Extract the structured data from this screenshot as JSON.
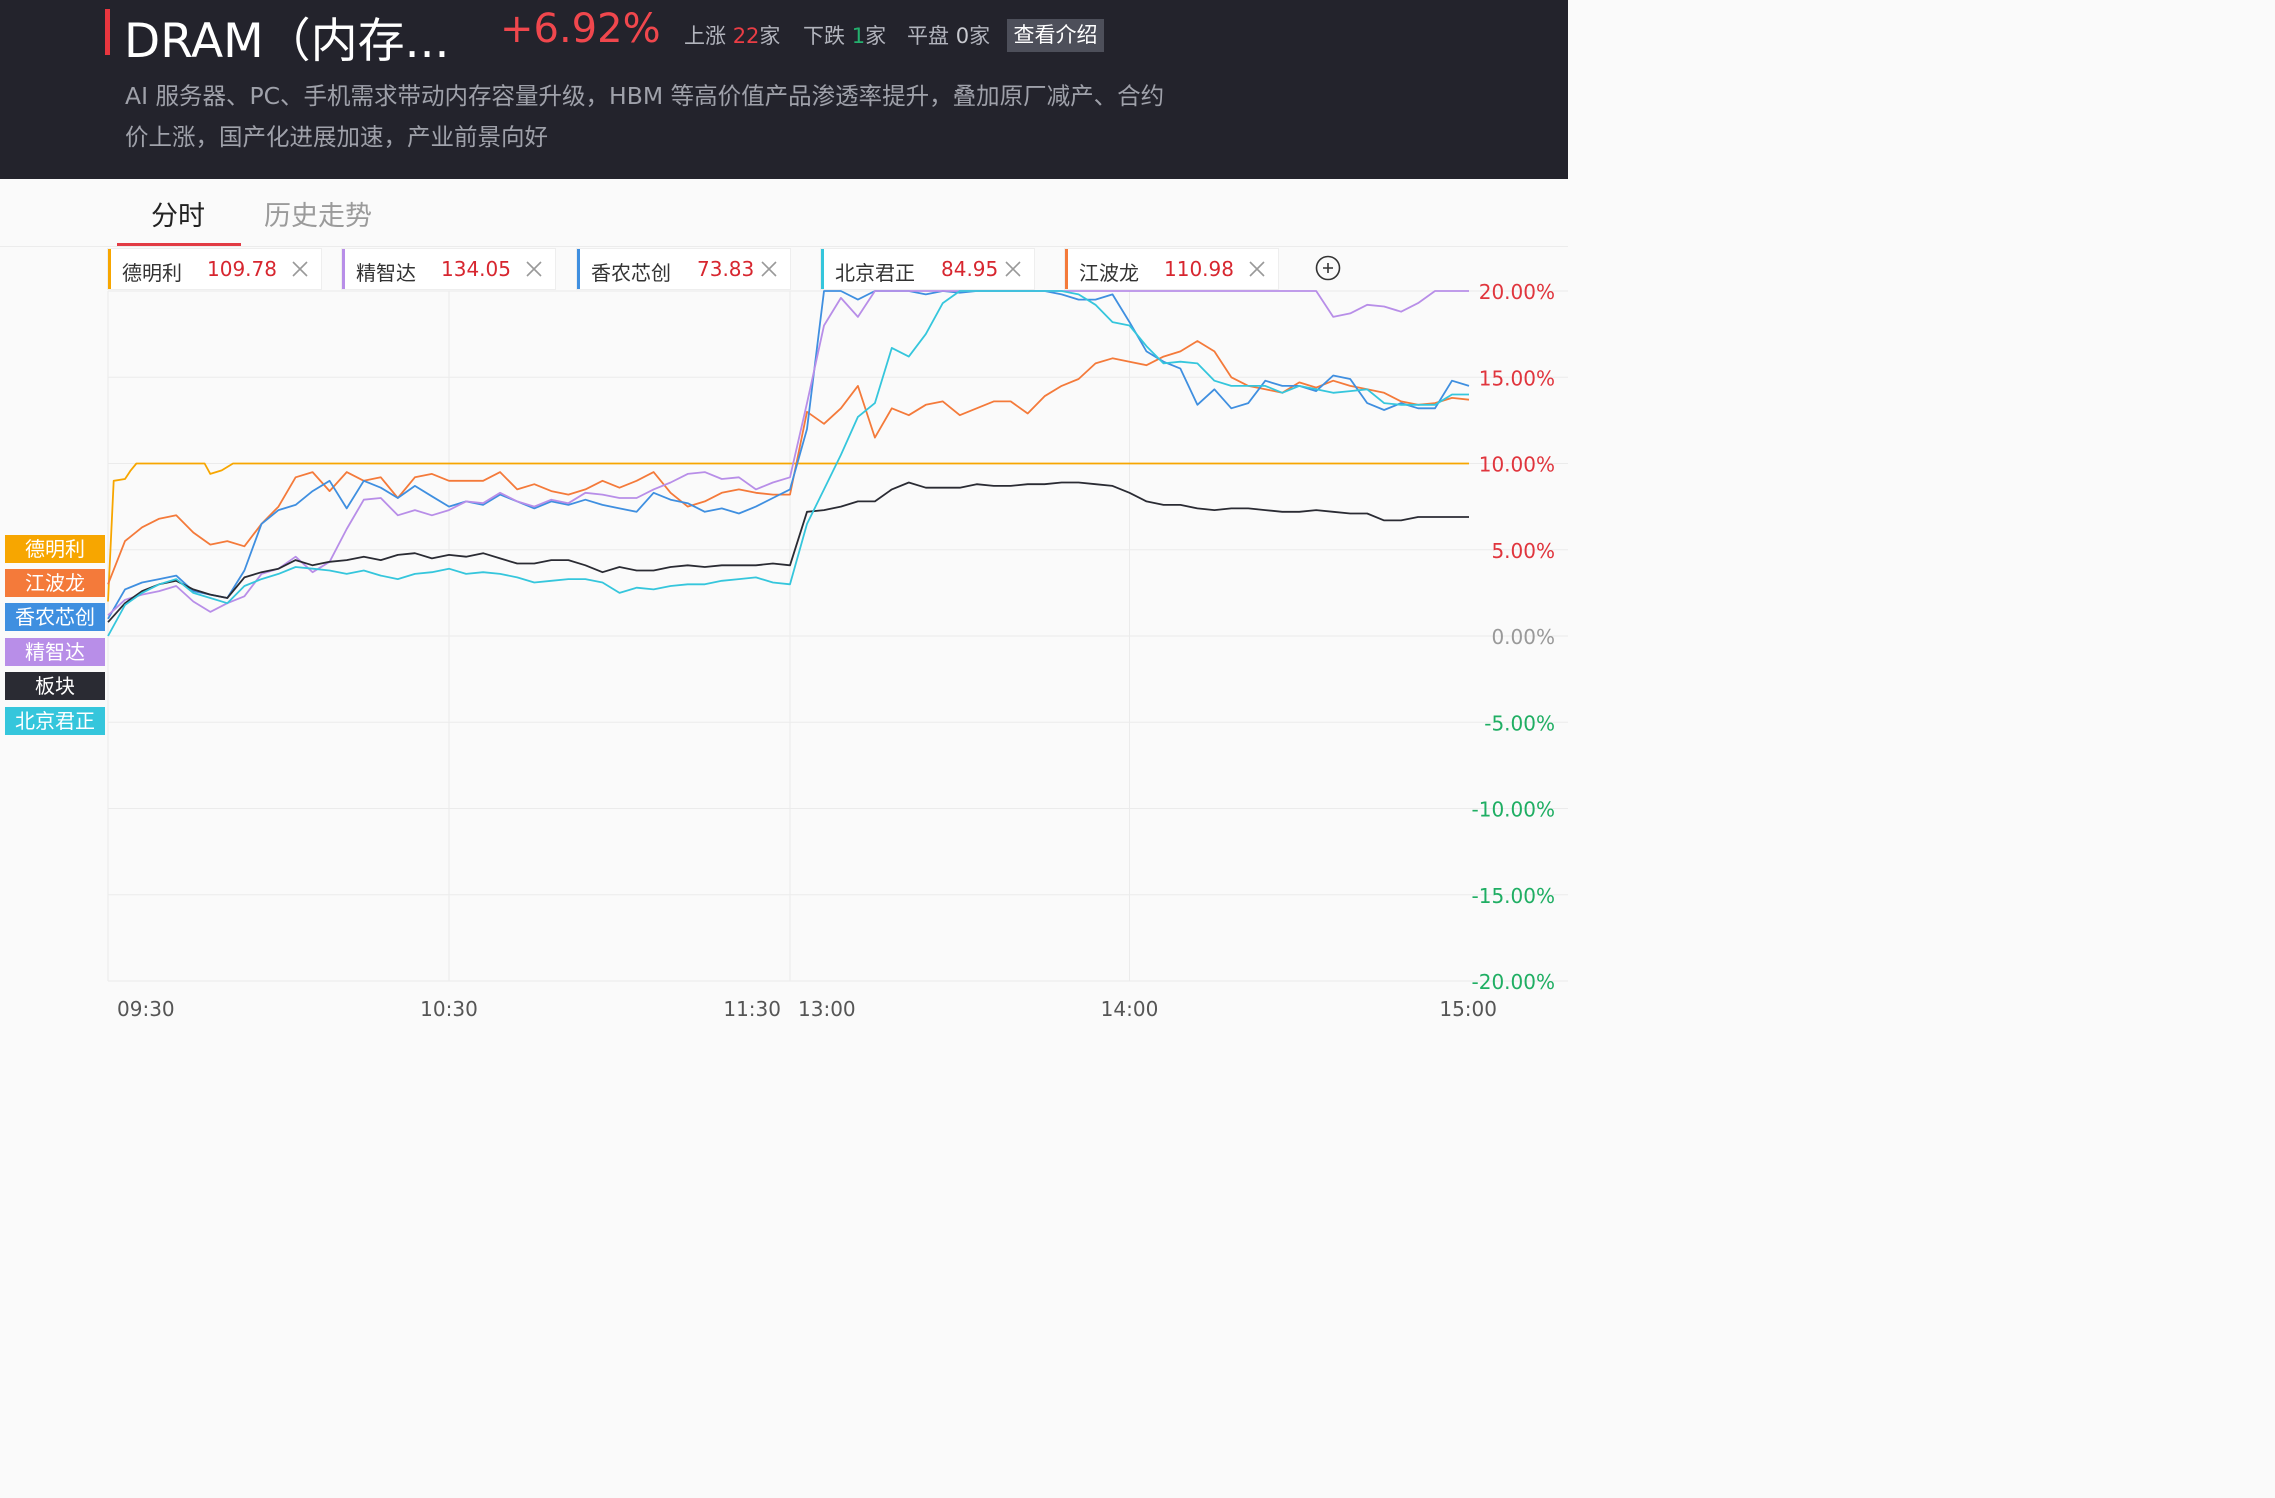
{
  "header": {
    "title": "DRAM（内存...",
    "change": "+6.92%",
    "up_label": "上涨",
    "up_count": "22",
    "up_unit": "家",
    "down_label": "下跌",
    "down_count": "1",
    "down_unit": "家",
    "flat_label": "平盘",
    "flat_count": "0",
    "flat_unit": "家",
    "intro_button": "查看介绍",
    "description": "AI 服务器、PC、手机需求带动内存容量升级，HBM 等高价值产品渗透率提升，叠加原厂减产、合约价上涨，国产化进展加速，产业前景向好"
  },
  "tabs": [
    {
      "label": "分时",
      "active": true
    },
    {
      "label": "历史走势",
      "active": false
    }
  ],
  "chips": [
    {
      "name": "德明利",
      "price": "109.78",
      "color": "#f7a600"
    },
    {
      "name": "精智达",
      "price": "134.05",
      "color": "#b88ee8"
    },
    {
      "name": "香农芯创",
      "price": "73.83",
      "color": "#3f8fe0"
    },
    {
      "name": "北京君正",
      "price": "84.95",
      "color": "#35c6dc"
    },
    {
      "name": "江波龙",
      "price": "110.98",
      "color": "#f47a3a"
    }
  ],
  "legend": [
    {
      "name": "德明利",
      "color": "#f7a600"
    },
    {
      "name": "江波龙",
      "color": "#f47a3a"
    },
    {
      "name": "香农芯创",
      "color": "#3f8fe0"
    },
    {
      "name": "精智达",
      "color": "#b88ee8"
    },
    {
      "name": "板块",
      "color": "#2a2b33"
    },
    {
      "name": "北京君正",
      "color": "#35c6dc"
    }
  ],
  "chart_data": {
    "type": "line",
    "ylim": [
      -20,
      20
    ],
    "y_ticks": [
      "20.00%",
      "15.00%",
      "10.00%",
      "5.00%",
      "0.00%",
      "-5.00%",
      "-10.00%",
      "-15.00%",
      "-20.00%"
    ],
    "x_ticks": [
      "09:30",
      "10:30",
      "11:30",
      "13:00",
      "14:00",
      "15:00"
    ],
    "x_range": [
      0,
      240
    ],
    "positive_color": "#e0353d",
    "negative_color": "#1fae63",
    "neutral_color": "#999999",
    "series": [
      {
        "name": "德明利",
        "color": "#f7a600",
        "x": [
          0,
          1,
          3,
          4,
          5,
          7,
          17,
          18,
          20,
          22,
          60,
          120,
          240
        ],
        "values": [
          2,
          9,
          9.1,
          9.6,
          10,
          10,
          10,
          9.4,
          9.6,
          10,
          10,
          10,
          10
        ]
      },
      {
        "name": "江波龙",
        "color": "#f47a3a",
        "x": [
          0,
          3,
          6,
          9,
          12,
          15,
          18,
          21,
          24,
          27,
          30,
          33,
          36,
          39,
          42,
          45,
          48,
          51,
          54,
          57,
          60,
          63,
          66,
          69,
          72,
          75,
          78,
          81,
          84,
          87,
          90,
          93,
          96,
          99,
          102,
          105,
          108,
          111,
          114,
          117,
          120,
          123,
          126,
          129,
          132,
          135,
          138,
          141,
          144,
          147,
          150,
          153,
          156,
          159,
          162,
          165,
          168,
          171,
          174,
          177,
          180,
          183,
          186,
          189,
          192,
          195,
          198,
          201,
          204,
          207,
          210,
          213,
          216,
          219,
          222,
          225,
          228,
          231,
          234,
          237,
          240
        ],
        "values": [
          3,
          5.5,
          6.3,
          6.8,
          7,
          6,
          5.3,
          5.5,
          5.2,
          6.5,
          7.5,
          9.2,
          9.5,
          8.4,
          9.5,
          9,
          9.2,
          8,
          9.2,
          9.4,
          9,
          9,
          9,
          9.5,
          8.5,
          8.8,
          8.4,
          8.2,
          8.5,
          9,
          8.6,
          9,
          9.5,
          8.3,
          7.5,
          7.8,
          8.3,
          8.5,
          8.3,
          8.2,
          8.2,
          13,
          12.3,
          13.2,
          14.5,
          11.5,
          13.2,
          12.8,
          13.4,
          13.6,
          12.8,
          13.2,
          13.6,
          13.6,
          12.9,
          13.9,
          14.5,
          14.9,
          15.8,
          16.1,
          15.9,
          15.7,
          16.2,
          16.5,
          17.1,
          16.5,
          15,
          14.5,
          14.3,
          14.1,
          14.7,
          14.4,
          14.8,
          14.5,
          14.3,
          14.1,
          13.6,
          13.4,
          13.5,
          13.8,
          13.7
        ]
      },
      {
        "name": "香农芯创",
        "color": "#3f8fe0",
        "x": [
          0,
          3,
          6,
          9,
          12,
          15,
          18,
          21,
          24,
          27,
          30,
          33,
          36,
          39,
          42,
          45,
          48,
          51,
          54,
          57,
          60,
          63,
          66,
          69,
          72,
          75,
          78,
          81,
          84,
          87,
          90,
          93,
          96,
          99,
          102,
          105,
          108,
          111,
          114,
          117,
          120,
          123,
          126,
          129,
          132,
          135,
          138,
          141,
          144,
          147,
          150,
          153,
          156,
          159,
          162,
          165,
          168,
          171,
          174,
          177,
          180,
          183,
          186,
          189,
          192,
          195,
          198,
          201,
          204,
          207,
          210,
          213,
          216,
          219,
          222,
          225,
          228,
          231,
          234,
          237,
          240
        ],
        "values": [
          1,
          2.7,
          3.1,
          3.3,
          3.5,
          2.6,
          2.4,
          2.2,
          3.8,
          6.5,
          7.3,
          7.6,
          8.4,
          9,
          7.4,
          9,
          8.6,
          8,
          8.7,
          8.1,
          7.5,
          7.8,
          7.6,
          8.2,
          7.8,
          7.4,
          7.8,
          7.6,
          7.9,
          7.6,
          7.4,
          7.2,
          8.3,
          7.9,
          7.7,
          7.2,
          7.4,
          7.1,
          7.5,
          8,
          8.5,
          12,
          20,
          20,
          19.5,
          20,
          20,
          20,
          19.8,
          20,
          19.9,
          20,
          20,
          20,
          20,
          20,
          19.8,
          19.5,
          19.5,
          19.8,
          18.2,
          16.5,
          15.9,
          15.5,
          13.4,
          14.3,
          13.2,
          13.5,
          14.8,
          14.5,
          14.5,
          14.2,
          15.1,
          14.9,
          13.5,
          13.1,
          13.5,
          13.2,
          13.2,
          14.8,
          14.5
        ]
      },
      {
        "name": "精智达",
        "color": "#b88ee8",
        "x": [
          0,
          3,
          6,
          9,
          12,
          15,
          18,
          21,
          24,
          27,
          30,
          33,
          36,
          39,
          42,
          45,
          48,
          51,
          54,
          57,
          60,
          63,
          66,
          69,
          72,
          75,
          78,
          81,
          84,
          87,
          90,
          93,
          96,
          99,
          102,
          105,
          108,
          111,
          114,
          117,
          120,
          123,
          126,
          129,
          132,
          135,
          138,
          141,
          144,
          147,
          150,
          153,
          156,
          159,
          162,
          165,
          168,
          171,
          174,
          177,
          180,
          183,
          186,
          189,
          192,
          195,
          198,
          201,
          204,
          207,
          210,
          213,
          216,
          219,
          222,
          225,
          228,
          231,
          234,
          237,
          240
        ],
        "values": [
          1.2,
          2.1,
          2.4,
          2.6,
          2.9,
          2,
          1.4,
          1.9,
          2.3,
          3.6,
          3.9,
          4.6,
          3.7,
          4.3,
          6.2,
          7.9,
          8,
          7,
          7.3,
          7,
          7.3,
          7.8,
          7.7,
          8.3,
          7.8,
          7.5,
          7.9,
          7.7,
          8.3,
          8.2,
          8,
          8,
          8.5,
          8.9,
          9.4,
          9.5,
          9.1,
          9.2,
          8.5,
          8.9,
          9.2,
          13.5,
          18,
          19.6,
          18.5,
          20,
          20,
          20,
          20,
          20,
          20,
          20,
          20,
          20,
          20,
          20,
          20,
          20,
          20,
          20,
          20,
          20,
          20,
          20,
          20,
          20,
          20,
          20,
          20,
          20,
          20,
          20,
          18.5,
          18.7,
          19.2,
          19.1,
          18.8,
          19.3,
          20,
          20,
          20
        ]
      },
      {
        "name": "板块",
        "color": "#2a2b33",
        "x": [
          0,
          3,
          6,
          9,
          12,
          15,
          18,
          21,
          24,
          27,
          30,
          33,
          36,
          39,
          42,
          45,
          48,
          51,
          54,
          57,
          60,
          63,
          66,
          69,
          72,
          75,
          78,
          81,
          84,
          87,
          90,
          93,
          96,
          99,
          102,
          105,
          108,
          111,
          114,
          117,
          120,
          123,
          126,
          129,
          132,
          135,
          138,
          141,
          144,
          147,
          150,
          153,
          156,
          159,
          162,
          165,
          168,
          171,
          174,
          177,
          180,
          183,
          186,
          189,
          192,
          195,
          198,
          201,
          204,
          207,
          210,
          213,
          216,
          219,
          222,
          225,
          228,
          231,
          234,
          237,
          240
        ],
        "values": [
          0.8,
          1.9,
          2.6,
          3,
          3.2,
          2.7,
          2.4,
          2.2,
          3.4,
          3.7,
          3.9,
          4.4,
          4.1,
          4.3,
          4.4,
          4.6,
          4.4,
          4.7,
          4.8,
          4.5,
          4.7,
          4.6,
          4.8,
          4.5,
          4.2,
          4.2,
          4.4,
          4.4,
          4.1,
          3.7,
          4,
          3.8,
          3.8,
          4,
          4.1,
          4,
          4.1,
          4.1,
          4.1,
          4.2,
          4.1,
          7.2,
          7.3,
          7.5,
          7.8,
          7.8,
          8.5,
          8.9,
          8.6,
          8.6,
          8.6,
          8.8,
          8.7,
          8.7,
          8.8,
          8.8,
          8.9,
          8.9,
          8.8,
          8.7,
          8.3,
          7.8,
          7.6,
          7.6,
          7.4,
          7.3,
          7.4,
          7.4,
          7.3,
          7.2,
          7.2,
          7.3,
          7.2,
          7.1,
          7.1,
          6.7,
          6.7,
          6.9,
          6.9,
          6.9,
          6.9
        ]
      },
      {
        "name": "北京君正",
        "color": "#35c6dc",
        "x": [
          0,
          3,
          6,
          9,
          12,
          15,
          18,
          21,
          24,
          27,
          30,
          33,
          36,
          39,
          42,
          45,
          48,
          51,
          54,
          57,
          60,
          63,
          66,
          69,
          72,
          75,
          78,
          81,
          84,
          87,
          90,
          93,
          96,
          99,
          102,
          105,
          108,
          111,
          114,
          117,
          120,
          123,
          126,
          129,
          132,
          135,
          138,
          141,
          144,
          147,
          150,
          153,
          156,
          159,
          162,
          165,
          168,
          171,
          174,
          177,
          180,
          183,
          186,
          189,
          192,
          195,
          198,
          201,
          204,
          207,
          210,
          213,
          216,
          219,
          222,
          225,
          228,
          231,
          234,
          237,
          240
        ],
        "values": [
          0,
          1.8,
          2.5,
          3,
          3.3,
          2.5,
          2.2,
          1.9,
          2.9,
          3.3,
          3.6,
          4,
          3.9,
          3.8,
          3.6,
          3.8,
          3.5,
          3.3,
          3.6,
          3.7,
          3.9,
          3.6,
          3.7,
          3.6,
          3.4,
          3.1,
          3.2,
          3.3,
          3.3,
          3.1,
          2.5,
          2.8,
          2.7,
          2.9,
          3,
          3,
          3.2,
          3.3,
          3.4,
          3.1,
          3,
          6.5,
          8.5,
          10.5,
          12.7,
          13.5,
          16.7,
          16.2,
          17.5,
          19.3,
          20,
          20,
          20,
          20,
          20,
          20,
          20,
          19.8,
          19.2,
          18.2,
          18,
          16.8,
          15.8,
          15.9,
          15.8,
          14.8,
          14.5,
          14.5,
          14.5,
          14.1,
          14.5,
          14.3,
          14.1,
          14.2,
          14.3,
          13.5,
          13.4,
          13.4,
          13.4,
          14,
          14
        ]
      }
    ]
  }
}
